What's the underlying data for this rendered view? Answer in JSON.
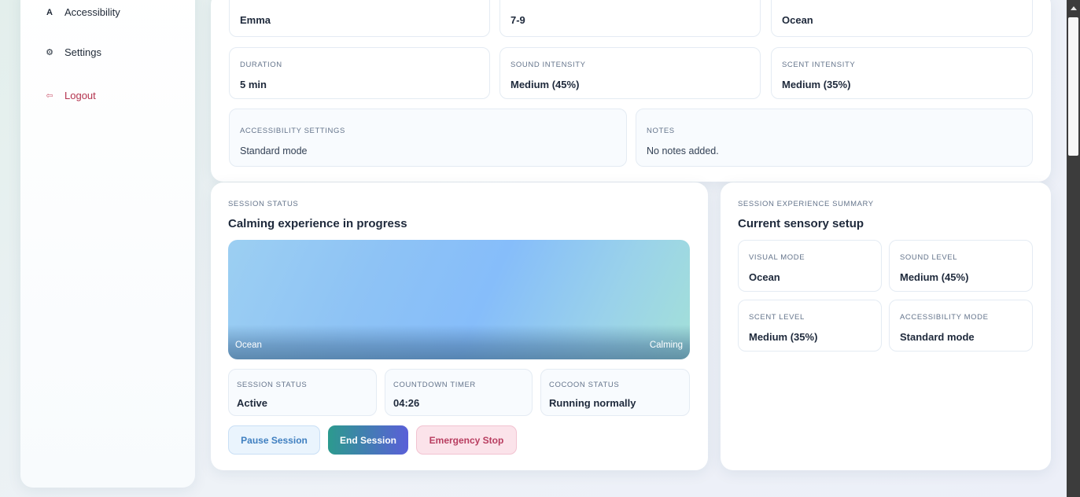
{
  "sidebar": {
    "items": [
      {
        "icon": "accessibility-icon",
        "glyph": "A",
        "label": "Accessibility"
      },
      {
        "icon": "gear-icon",
        "glyph": "⚙",
        "label": "Settings"
      },
      {
        "icon": "logout-icon",
        "glyph": "⇦",
        "label": "Logout"
      }
    ]
  },
  "config": {
    "child_name": "Emma",
    "age_group": "7-9",
    "visual_theme": "Ocean",
    "duration": {
      "label": "DURATION",
      "value": "5 min"
    },
    "sound_intensity": {
      "label": "SOUND INTENSITY",
      "value": "Medium (45%)"
    },
    "scent_intensity": {
      "label": "SCENT INTENSITY",
      "value": "Medium (35%)"
    },
    "accessibility": {
      "label": "ACCESSIBILITY SETTINGS",
      "value": "Standard mode"
    },
    "notes": {
      "label": "NOTES",
      "value": "No notes added."
    }
  },
  "session": {
    "eyebrow": "SESSION STATUS",
    "heading": "Calming experience in progress",
    "visual_left": "Ocean",
    "visual_right": "Calming",
    "status": {
      "label": "SESSION STATUS",
      "value": "Active"
    },
    "timer": {
      "label": "COUNTDOWN TIMER",
      "value": "04:26"
    },
    "cocoon": {
      "label": "COCOON STATUS",
      "value": "Running normally"
    },
    "buttons": {
      "pause": "Pause Session",
      "end": "End Session",
      "emergency": "Emergency Stop"
    }
  },
  "summary": {
    "eyebrow": "SESSION EXPERIENCE SUMMARY",
    "heading": "Current sensory setup",
    "visual_mode": {
      "label": "VISUAL MODE",
      "value": "Ocean"
    },
    "sound_level": {
      "label": "SOUND LEVEL",
      "value": "Medium (45%)"
    },
    "scent_level": {
      "label": "SCENT LEVEL",
      "value": "Medium (35%)"
    },
    "accessibility_mode": {
      "label": "ACCESSIBILITY MODE",
      "value": "Standard mode"
    }
  },
  "colors": {
    "accent_teal": "#2c9a8e",
    "accent_indigo": "#5a5fd8",
    "danger": "#b83d60",
    "logout": "#b4334e"
  }
}
